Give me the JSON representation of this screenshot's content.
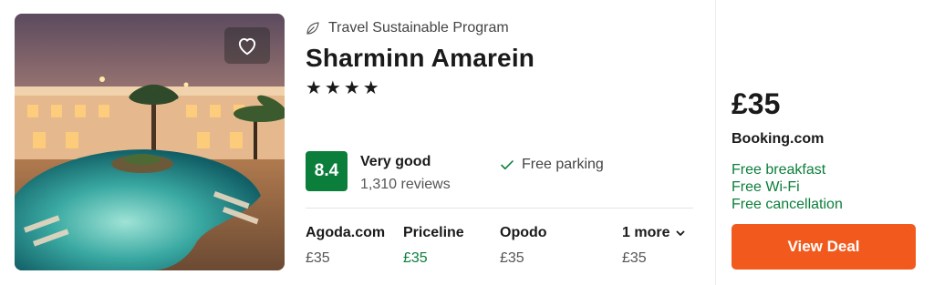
{
  "hotel": {
    "program": "Travel Sustainable Program",
    "name": "Sharminn Amarein",
    "stars": "★★★★",
    "star_rating": 4
  },
  "rating": {
    "score": "8.4",
    "label": "Very good",
    "reviews": "1,310 reviews"
  },
  "amenity": "Free parking",
  "providers": [
    {
      "name": "Agoda.com",
      "price": "£35"
    },
    {
      "name": "Priceline",
      "price": "£35"
    },
    {
      "name": "Opodo",
      "price": "£35"
    },
    {
      "name": "1 more",
      "price": "£35"
    }
  ],
  "deal": {
    "price": "£35",
    "provider": "Booking.com",
    "perks": [
      "Free breakfast",
      "Free Wi-Fi",
      "Free cancellation"
    ],
    "button_label": "View Deal"
  },
  "icons": {
    "favorite": "heart-icon",
    "program": "leaf-icon",
    "amenity": "check-icon",
    "more": "chevron-down-icon"
  },
  "colors": {
    "accent_green": "#0b7e3b",
    "deal_button": "#f25a1d",
    "score_badge": "#0b7e3b"
  }
}
